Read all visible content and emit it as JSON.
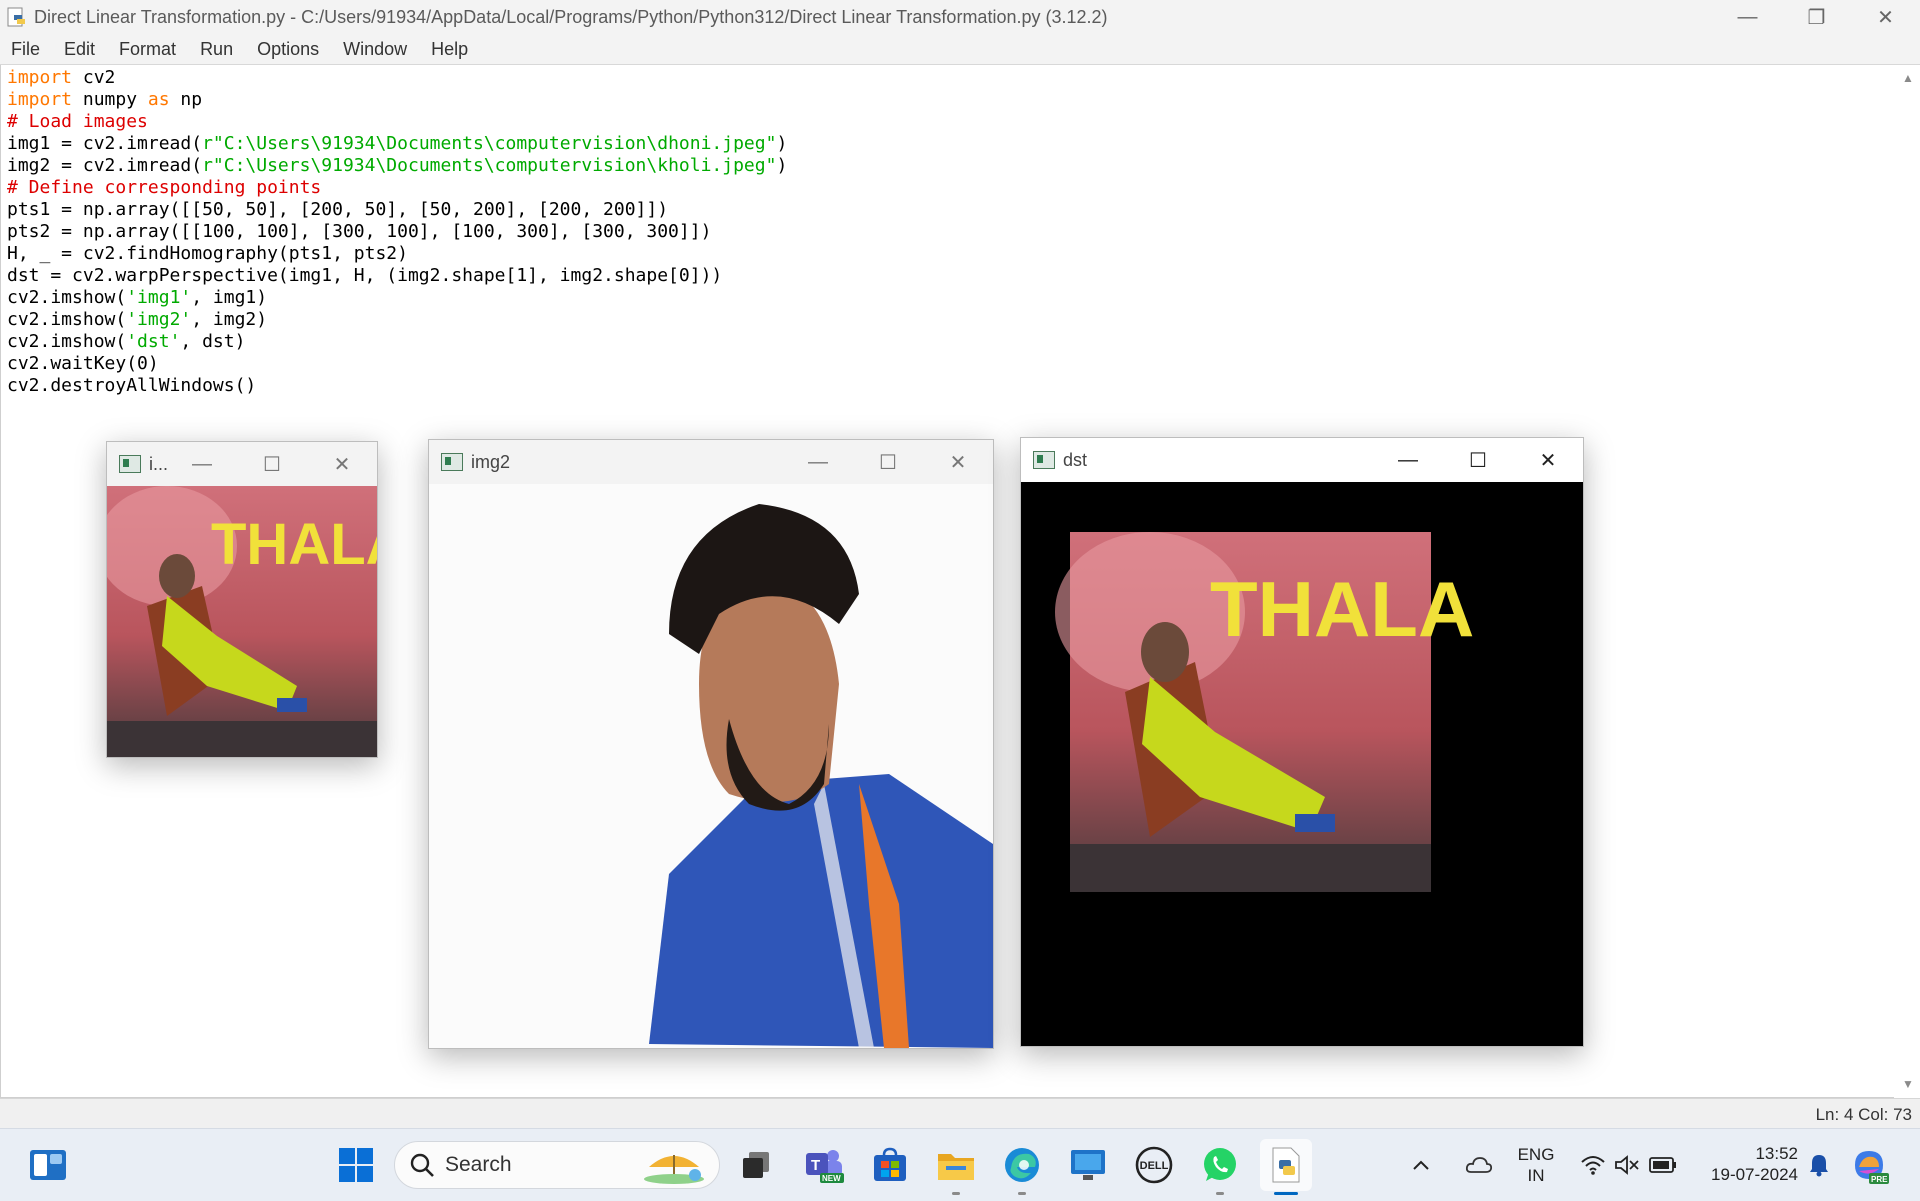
{
  "window": {
    "title": "Direct Linear Transformation.py - C:/Users/91934/AppData/Local/Programs/Python/Python312/Direct Linear Transformation.py (3.12.2)",
    "controls": {
      "minimize": "—",
      "restore": "❐",
      "close": "✕"
    }
  },
  "menu": [
    "File",
    "Edit",
    "Format",
    "Run",
    "Options",
    "Window",
    "Help"
  ],
  "code": [
    [
      {
        "t": "import",
        "c": "kw"
      },
      {
        "t": " cv2",
        "c": ""
      }
    ],
    [
      {
        "t": "import",
        "c": "kw"
      },
      {
        "t": " numpy ",
        "c": ""
      },
      {
        "t": "as",
        "c": "kw"
      },
      {
        "t": " np",
        "c": ""
      }
    ],
    [
      {
        "t": "# Load images",
        "c": "cm"
      }
    ],
    [
      {
        "t": "img1 = cv2.imread(",
        "c": ""
      },
      {
        "t": "r\"C:\\Users\\91934\\Documents\\computervision\\dhoni.jpeg\"",
        "c": "st"
      },
      {
        "t": ")",
        "c": ""
      }
    ],
    [
      {
        "t": "img2 = cv2.imread(",
        "c": ""
      },
      {
        "t": "r\"C:\\Users\\91934\\Documents\\computervision\\kholi.jpeg\"",
        "c": "st"
      },
      {
        "t": ")",
        "c": ""
      }
    ],
    [
      {
        "t": "# Define corresponding points",
        "c": "cm"
      }
    ],
    [
      {
        "t": "pts1 = np.array([[50, 50], [200, 50], [50, 200], [200, 200]])",
        "c": ""
      }
    ],
    [
      {
        "t": "pts2 = np.array([[100, 100], [300, 100], [100, 300], [300, 300]])",
        "c": ""
      }
    ],
    [
      {
        "t": "H, _ = cv2.findHomography(pts1, pts2)",
        "c": ""
      }
    ],
    [
      {
        "t": "dst = cv2.warpPerspective(img1, H, (img2.shape[1], img2.shape[0]))",
        "c": ""
      }
    ],
    [
      {
        "t": "cv2.imshow(",
        "c": ""
      },
      {
        "t": "'img1'",
        "c": "st"
      },
      {
        "t": ", img1)",
        "c": ""
      }
    ],
    [
      {
        "t": "cv2.imshow(",
        "c": ""
      },
      {
        "t": "'img2'",
        "c": "st"
      },
      {
        "t": ", img2)",
        "c": ""
      }
    ],
    [
      {
        "t": "cv2.imshow(",
        "c": ""
      },
      {
        "t": "'dst'",
        "c": "st"
      },
      {
        "t": ", dst)",
        "c": ""
      }
    ],
    [
      {
        "t": "cv2.waitKey(0)",
        "c": ""
      }
    ],
    [
      {
        "t": "cv2.destroyAllWindows()",
        "c": ""
      }
    ]
  ],
  "status": {
    "position": "Ln: 4   Col: 73"
  },
  "cv_windows": {
    "img1": {
      "title": "i...",
      "poster_text": "THALA"
    },
    "img2": {
      "title": "img2"
    },
    "dst": {
      "title": "dst",
      "poster_text": "THALA"
    },
    "controls": {
      "minimize": "—",
      "maximize": "☐",
      "close": "✕"
    }
  },
  "taskbar": {
    "search_placeholder": "Search",
    "teams_badge": "NEW",
    "dell_label": "DELL",
    "copilot_badge": "PRE",
    "language": "ENG",
    "region": "IN",
    "time": "13:52",
    "date": "19-07-2024"
  },
  "colors": {
    "keyword": "#ff7700",
    "comment": "#dd0000",
    "string": "#00aa00",
    "taskbar_accent": "#0067c0"
  }
}
